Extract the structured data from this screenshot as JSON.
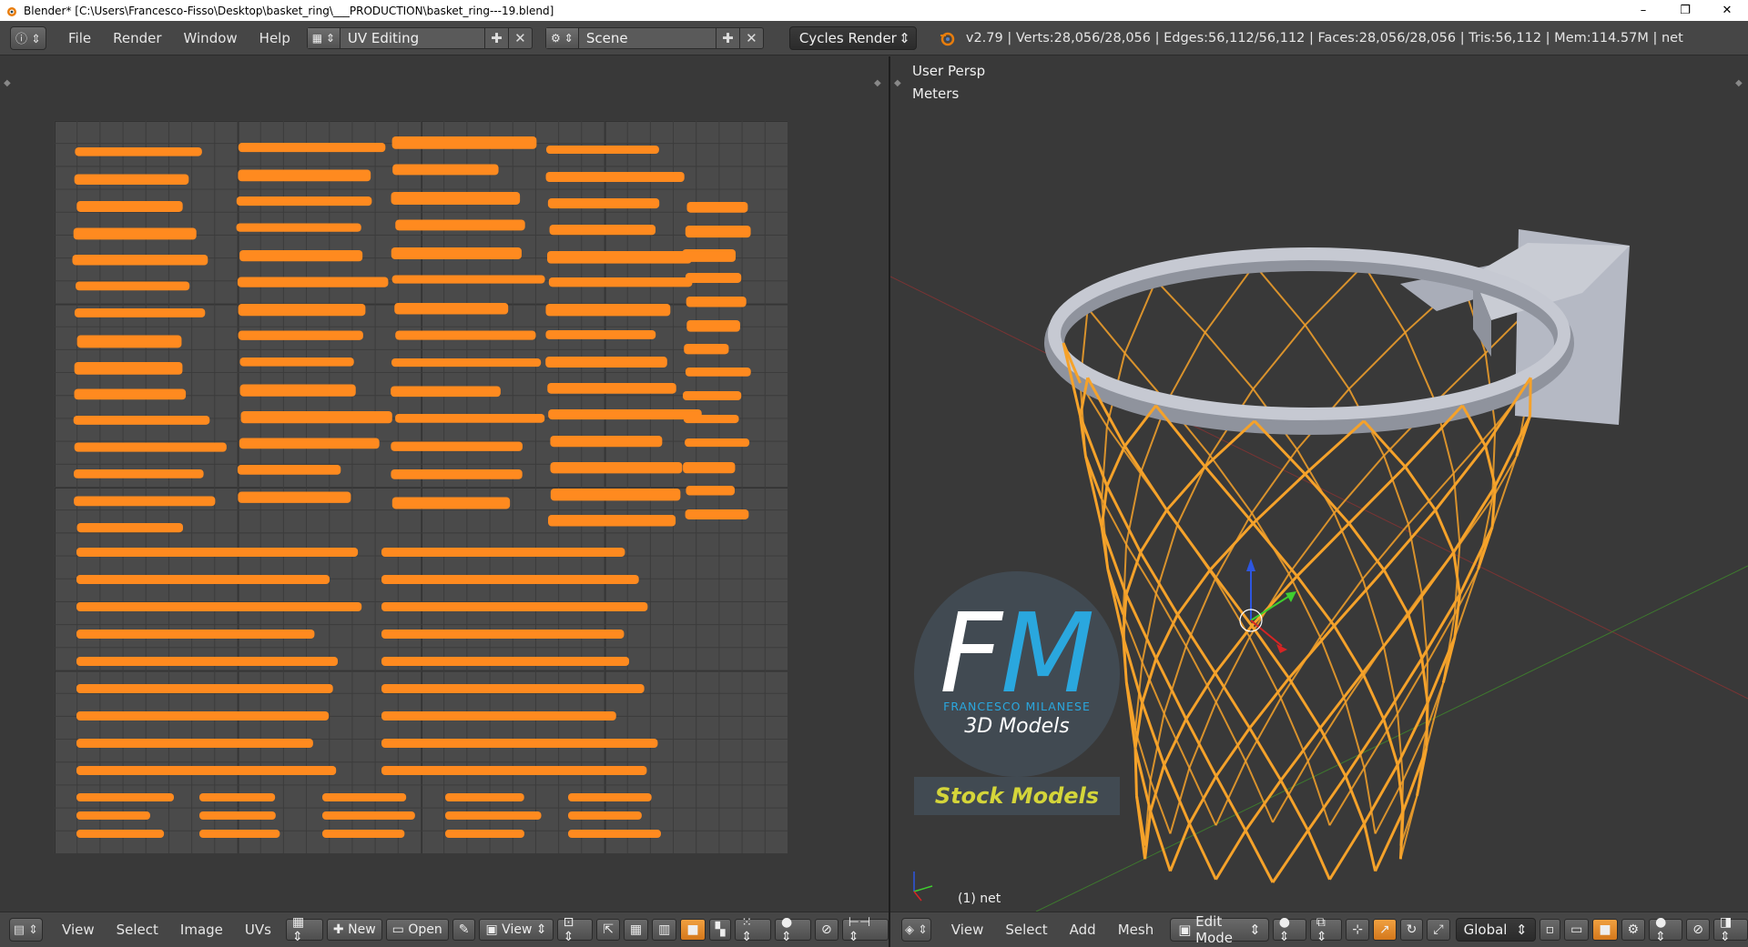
{
  "window": {
    "title": "Blender* [C:\\Users\\Francesco-Fisso\\Desktop\\basket_ring\\___PRODUCTION\\basket_ring---19.blend]",
    "minimize": "–",
    "restore": "❐",
    "close": "✕"
  },
  "info_header": {
    "menus": [
      "File",
      "Render",
      "Window",
      "Help"
    ],
    "layout": "UV Editing",
    "scene": "Scene",
    "render_engine": "Cycles Render",
    "stats": "v2.79 | Verts:28,056/28,056 | Edges:56,112/56,112 | Faces:28,056/28,056 | Tris:56,112 | Mem:114.57M | net"
  },
  "viewport": {
    "view_name": "User Persp",
    "units": "Meters",
    "object_label": "(1) net"
  },
  "watermark": {
    "letter_f": "F",
    "letter_m": "M",
    "name": "FRANCESCO MILANESE",
    "subtitle": "3D Models",
    "badge": "Stock Models"
  },
  "uv_footer": {
    "menus": [
      "View",
      "Select",
      "Image",
      "UVs"
    ],
    "new_label": "New",
    "open_label": "Open",
    "view_select": "View"
  },
  "view3d_footer": {
    "menus": [
      "View",
      "Select",
      "Add",
      "Mesh"
    ],
    "mode": "Edit Mode",
    "orientation": "Global"
  },
  "colors": {
    "uv_island": "#ff8a1f",
    "net": "#f5a22a",
    "ring": "#b9bcc6"
  }
}
